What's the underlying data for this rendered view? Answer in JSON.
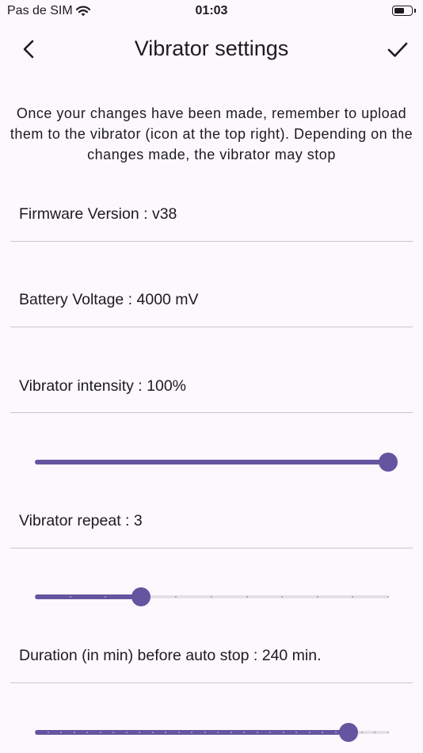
{
  "status_bar": {
    "carrier": "Pas de SIM",
    "time": "01:03",
    "battery_level": 0.65
  },
  "header": {
    "title": "Vibrator settings",
    "back_icon": "chevron-left-icon",
    "confirm_icon": "check-icon"
  },
  "notice": "Once your changes have been made, remember to upload them to the vibrator (icon at the top right). Depending on the changes made, the vibrator may stop",
  "settings": {
    "firmware": "Firmware Version : v38",
    "battery": "Battery Voltage : 4000 mV",
    "intensity": {
      "label": "Vibrator intensity : 100%",
      "value": 100,
      "min": 0,
      "max": 100,
      "divisions": 0
    },
    "repeat": {
      "label": "Vibrator repeat : 3",
      "value": 3,
      "min": 0,
      "max": 10,
      "divisions": 10
    },
    "duration": {
      "label": "Duration (in min) before auto stop : 240 min.",
      "value": 240,
      "min": 0,
      "max": 270,
      "divisions": 27
    }
  },
  "colors": {
    "accent": "#63559f",
    "track_inactive": "#e4e0e8",
    "background": "#fbf8fe",
    "divider": "#c9c6cf"
  }
}
